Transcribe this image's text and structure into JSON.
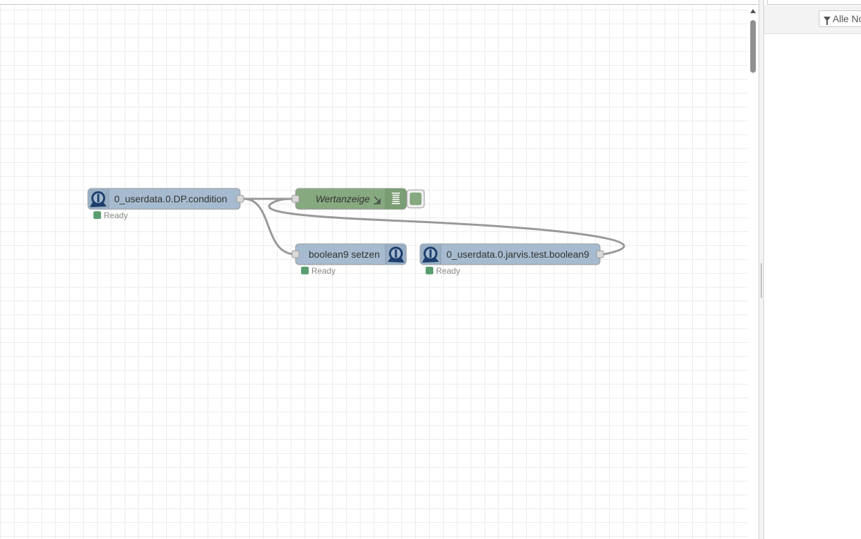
{
  "sidebar": {
    "filter_label": "Alle No"
  },
  "nodes": {
    "condition": {
      "label": "0_userdata.0.DP.condition",
      "status": "Ready"
    },
    "wertanzeige": {
      "label": "Wertanzeige"
    },
    "boolean9_setzen": {
      "label": "boolean9 setzen",
      "status": "Ready"
    },
    "boolean9_in": {
      "label": "0_userdata.0.jarvis.test.boolean9",
      "status": "Ready"
    }
  },
  "colors": {
    "iobroker_node": "#a6bbcf",
    "debug_node": "#87a980",
    "status_ok": "#5a9e6f",
    "wire": "#999999"
  },
  "icons": {
    "iobroker": "iobroker-logo-icon",
    "debug": "debug-list-icon",
    "filter": "filter-icon"
  }
}
